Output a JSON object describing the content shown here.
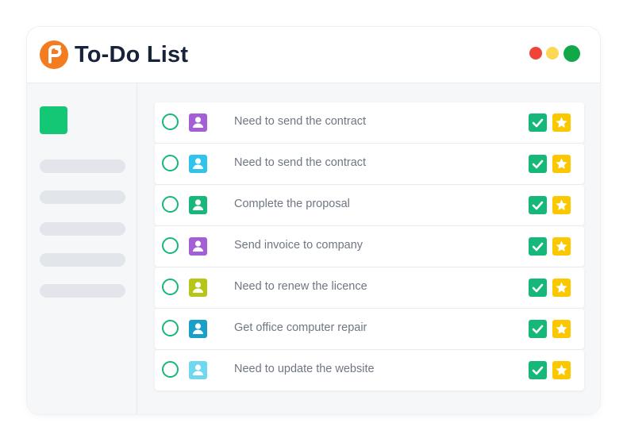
{
  "app": {
    "title": "To-Do List"
  },
  "colors": {
    "logo": "#f47c20",
    "title": "#17223b",
    "traffic_red": "#f04438",
    "traffic_yellow": "#fdd854",
    "traffic_green": "#12a84a",
    "sidebar_accent": "#14c774",
    "check": "#16b87a",
    "done_button": "#16b87a",
    "star_button": "#fbc800"
  },
  "sidebar": {
    "accent_icon": "square-block",
    "items": [
      "",
      "",
      "",
      "",
      ""
    ]
  },
  "tasks": [
    {
      "text": "Need to send the contract",
      "avatar_color": "#a45fd6",
      "avatar_icon": "user-icon"
    },
    {
      "text": "Need to send the contract",
      "avatar_color": "#30c4ec",
      "avatar_icon": "user-icon"
    },
    {
      "text": "Complete the proposal",
      "avatar_color": "#18b87a",
      "avatar_icon": "user-icon"
    },
    {
      "text": "Send invoice to company",
      "avatar_color": "#a45fd6",
      "avatar_icon": "user-icon"
    },
    {
      "text": "Need to renew the licence",
      "avatar_color": "#b7c516",
      "avatar_icon": "user-icon"
    },
    {
      "text": "Get office computer repair",
      "avatar_color": "#1a9fc9",
      "avatar_icon": "user-icon"
    },
    {
      "text": "Need to update the website",
      "avatar_color": "#6fd7ef",
      "avatar_icon": "user-icon"
    }
  ]
}
